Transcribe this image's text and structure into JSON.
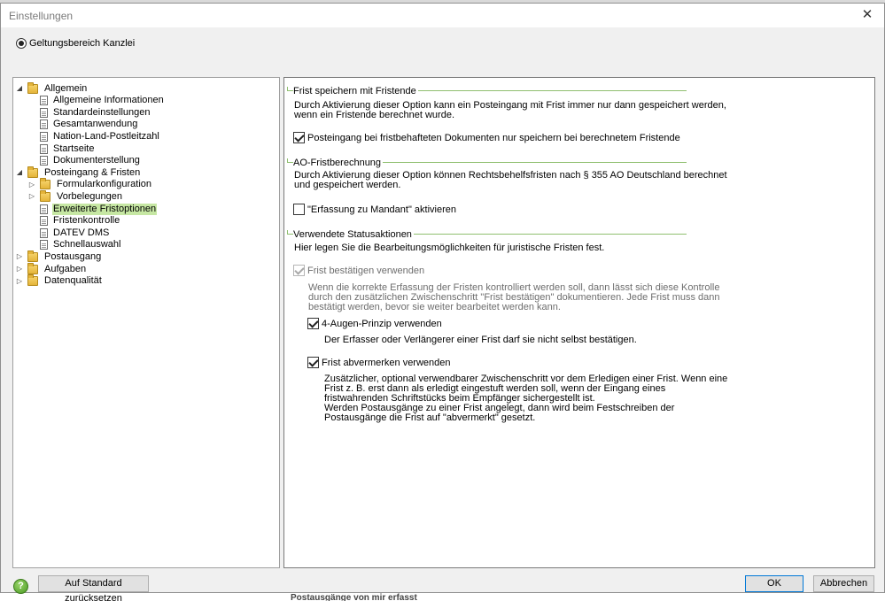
{
  "dialog": {
    "title": "Einstellungen",
    "close_symbol": "✕",
    "scope_label": "Geltungsbereich Kanzlei"
  },
  "tree": {
    "items": [
      {
        "label": "Allgemein",
        "level": 0,
        "type": "folder",
        "expander": "◢"
      },
      {
        "label": "Allgemeine Informationen",
        "level": 1,
        "type": "doc"
      },
      {
        "label": "Standardeinstellungen",
        "level": 1,
        "type": "doc"
      },
      {
        "label": "Gesamtanwendung",
        "level": 1,
        "type": "doc"
      },
      {
        "label": "Nation-Land-Postleitzahl",
        "level": 1,
        "type": "doc"
      },
      {
        "label": "Startseite",
        "level": 1,
        "type": "doc"
      },
      {
        "label": "Dokumenterstellung",
        "level": 1,
        "type": "doc"
      },
      {
        "label": "Posteingang & Fristen",
        "level": 0,
        "type": "folder",
        "expander": "◢"
      },
      {
        "label": "Formularkonfiguration",
        "level": 1,
        "type": "folder",
        "expander": "▷"
      },
      {
        "label": "Vorbelegungen",
        "level": 1,
        "type": "folder",
        "expander": "▷"
      },
      {
        "label": "Erweiterte Fristoptionen",
        "level": 1,
        "type": "doc",
        "selected": true
      },
      {
        "label": "Fristenkontrolle",
        "level": 1,
        "type": "doc"
      },
      {
        "label": "DATEV DMS",
        "level": 1,
        "type": "doc"
      },
      {
        "label": "Schnellauswahl",
        "level": 1,
        "type": "doc"
      },
      {
        "label": "Postausgang",
        "level": 0,
        "type": "folder",
        "expander": "▷"
      },
      {
        "label": "Aufgaben",
        "level": 0,
        "type": "folder",
        "expander": "▷"
      },
      {
        "label": "Datenqualität",
        "level": 0,
        "type": "folder",
        "expander": "▷"
      }
    ]
  },
  "panel": {
    "group1": {
      "title": "Frist speichern mit Fristende",
      "desc1": "Durch Aktivierung dieser Option kann ein Posteingang mit Frist immer nur dann gespeichert werden,",
      "desc2": "wenn ein Fristende berechnet wurde.",
      "checkbox_label": "Posteingang bei fristbehafteten Dokumenten nur speichern bei berechnetem Fristende",
      "checked": true
    },
    "group2": {
      "title": "AO-Fristberechnung",
      "desc1": "Durch Aktivierung dieser Option können Rechtsbehelfsfristen nach § 355 AO Deutschland berechnet",
      "desc2": "und gespeichert werden.",
      "checkbox_label": "\"Erfassung zu Mandant\" aktivieren",
      "checked": false
    },
    "group3": {
      "title": "Verwendete Statusaktionen",
      "desc": "Hier legen Sie die Bearbeitungsmöglichkeiten für juristische Fristen fest.",
      "confirm_label": "Frist bestätigen verwenden",
      "confirm_desc1": "Wenn die korrekte Erfassung der Fristen kontrolliert werden soll, dann lässt sich diese Kontrolle",
      "confirm_desc2": "durch den zusätzlichen Zwischenschritt \"Frist bestätigen\" dokumentieren. Jede Frist muss dann",
      "confirm_desc3": "bestätigt werden, bevor sie weiter bearbeitet werden kann.",
      "four_eyes_label": "4-Augen-Prinzip verwenden",
      "four_eyes_desc": "Der Erfasser oder Verlängerer einer Frist darf sie nicht selbst bestätigen.",
      "note_label": "Frist abvermerken verwenden",
      "note_desc1": "Zusätzlicher, optional verwendbarer Zwischenschritt vor dem Erledigen einer Frist. Wenn eine",
      "note_desc2": "Frist z. B. erst dann als erledigt eingestuft werden soll, wenn der Eingang eines",
      "note_desc3": "fristwahrenden Schriftstücks beim Empfänger sichergestellt ist.",
      "note_desc4": "Werden Postausgänge zu einer Frist angelegt, dann wird beim Festschreiben der",
      "note_desc5": "Postausgänge die Frist auf \"abvermerkt\" gesetzt."
    }
  },
  "footer": {
    "help_symbol": "?",
    "reset_label": "Auf Standard zurücksetzen",
    "ok_label": "OK",
    "cancel_label": "Abbrechen"
  },
  "background": {
    "bottom_text": "Postausgänge von mir erfasst"
  }
}
